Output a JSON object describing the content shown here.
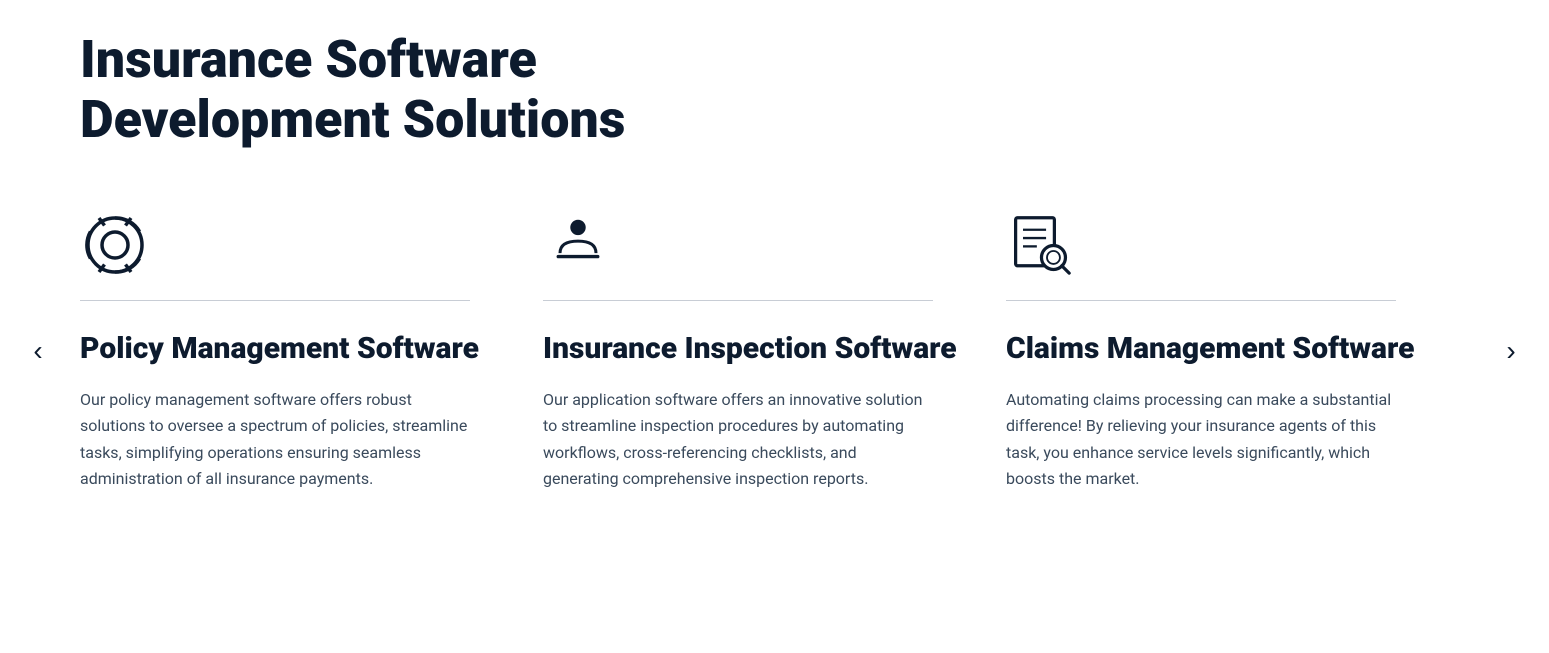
{
  "page": {
    "title_line1": "Insurance Software",
    "title_line2": "Development Solutions"
  },
  "cards": [
    {
      "id": "policy",
      "icon": "lifesaver-icon",
      "title": "Policy Management Software",
      "text": "Our policy management software offers robust solutions to oversee a spectrum of policies, streamline tasks, simplifying operations ensuring seamless administration of all insurance payments."
    },
    {
      "id": "inspection",
      "icon": "inspection-person-icon",
      "title": "Insurance Inspection Software",
      "text": "Our application software offers an innovative solution to streamline inspection procedures by automating workflows, cross-referencing checklists, and generating comprehensive inspection reports."
    },
    {
      "id": "claims",
      "icon": "document-search-icon",
      "title": "Claims Management Software",
      "text": "Automating claims processing can make a substantial difference! By relieving your insurance agents of this task, you enhance service levels significantly, which boosts the market."
    }
  ],
  "nav": {
    "prev_label": "‹",
    "next_label": "›"
  }
}
